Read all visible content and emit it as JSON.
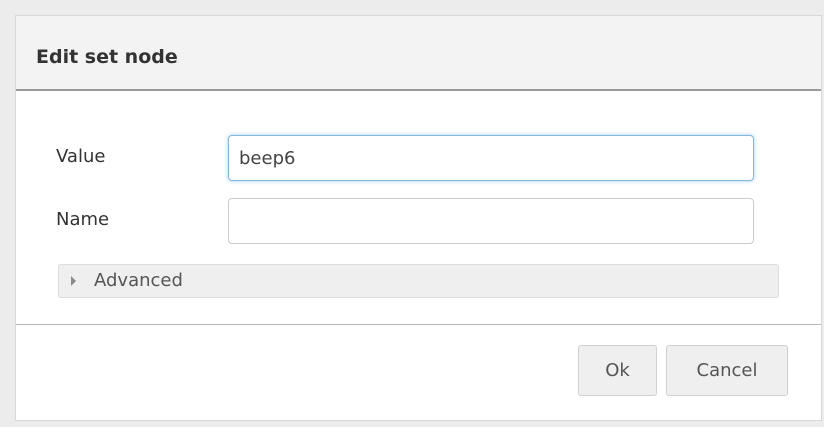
{
  "dialog": {
    "title": "Edit set node",
    "fields": {
      "value": {
        "label": "Value",
        "current_value": "beep6",
        "placeholder": ""
      },
      "name": {
        "label": "Name",
        "current_value": "",
        "placeholder": ""
      }
    },
    "advanced": {
      "label": "Advanced",
      "expanded": false,
      "icon": "caret-right-icon"
    },
    "buttons": {
      "ok_label": "Ok",
      "cancel_label": "Cancel"
    }
  }
}
